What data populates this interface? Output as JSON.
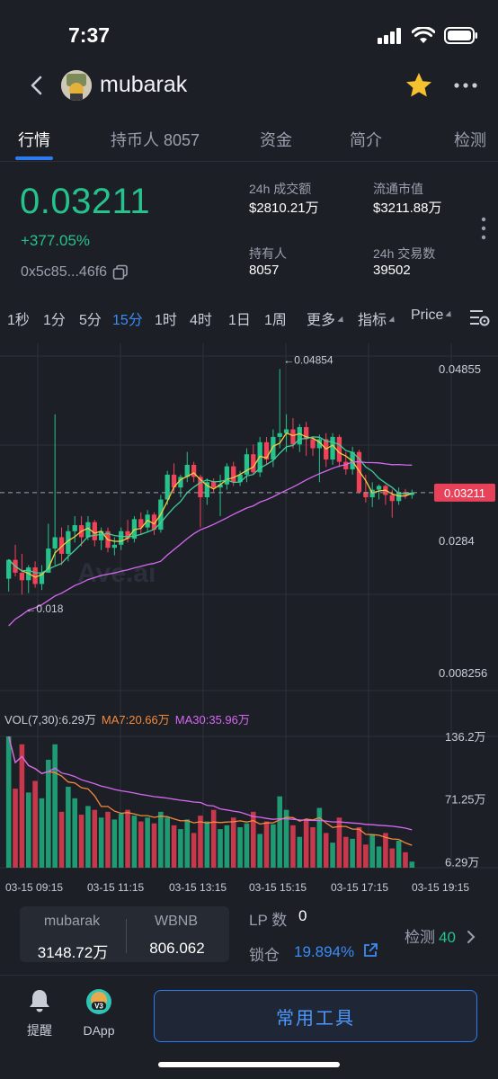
{
  "status_bar": {
    "time": "7:37",
    "icons": [
      "cellular-signal-icon",
      "wifi-icon",
      "battery-icon"
    ]
  },
  "header": {
    "token_name": "mubarak",
    "icons": [
      "back-arrow-icon",
      "token-avatar-icon",
      "star-icon",
      "more-dots-icon"
    ]
  },
  "tabs": [
    {
      "label": "行情",
      "active": true
    },
    {
      "label": "持币人 8057",
      "active": false
    },
    {
      "label": "资金",
      "active": false
    },
    {
      "label": "简介",
      "active": false
    },
    {
      "label": "检测",
      "active": false
    }
  ],
  "price": {
    "current": "0.03211",
    "change": "+377.05%",
    "address": "0x5c85...46f6"
  },
  "stats": [
    {
      "label": "24h 成交额",
      "value": "$2810.21万"
    },
    {
      "label": "流通市值",
      "value": "$3211.88万"
    },
    {
      "label": "持有人",
      "value": "8057"
    },
    {
      "label": "24h 交易数",
      "value": "39502"
    }
  ],
  "timeframes": [
    {
      "label": "1秒",
      "active": false
    },
    {
      "label": "1分",
      "active": false
    },
    {
      "label": "5分",
      "active": false
    },
    {
      "label": "15分",
      "active": true
    },
    {
      "label": "1时",
      "active": false
    },
    {
      "label": "4时",
      "active": false
    },
    {
      "label": "1日",
      "active": false
    },
    {
      "label": "1周",
      "active": false
    }
  ],
  "dropdowns": [
    {
      "label": "更多"
    },
    {
      "label": "指标"
    },
    {
      "label": "Price"
    }
  ],
  "chart_data": {
    "type": "candlestick",
    "watermark": "Ave.ai",
    "price_axis_labels": [
      "0.04855",
      "0.0284",
      "0.008256"
    ],
    "y_range": [
      0.008256,
      0.04855
    ],
    "current_price_tag": "0.03211",
    "high_annotation": "0.04854",
    "low_annotation": "0.018",
    "x_tick_labels": [
      "03-15 09:15",
      "03-15 11:15",
      "03-15 13:15",
      "03-15 15:15",
      "03-15 17:15",
      "03-15 19:15"
    ],
    "candles": [
      {
        "o": 0.0207,
        "h": 0.0233,
        "l": 0.019,
        "c": 0.0232
      },
      {
        "o": 0.0232,
        "h": 0.0252,
        "l": 0.021,
        "c": 0.0215
      },
      {
        "o": 0.0215,
        "h": 0.024,
        "l": 0.0186,
        "c": 0.0205
      },
      {
        "o": 0.0205,
        "h": 0.0225,
        "l": 0.0188,
        "c": 0.0222
      },
      {
        "o": 0.0222,
        "h": 0.023,
        "l": 0.0195,
        "c": 0.02
      },
      {
        "o": 0.02,
        "h": 0.0225,
        "l": 0.0192,
        "c": 0.0215
      },
      {
        "o": 0.0215,
        "h": 0.028,
        "l": 0.0215,
        "c": 0.0247
      },
      {
        "o": 0.0247,
        "h": 0.0425,
        "l": 0.0225,
        "c": 0.0262
      },
      {
        "o": 0.0262,
        "h": 0.0275,
        "l": 0.0225,
        "c": 0.024
      },
      {
        "o": 0.024,
        "h": 0.0278,
        "l": 0.023,
        "c": 0.027
      },
      {
        "o": 0.027,
        "h": 0.029,
        "l": 0.0255,
        "c": 0.0278
      },
      {
        "o": 0.0278,
        "h": 0.029,
        "l": 0.025,
        "c": 0.0262
      },
      {
        "o": 0.0262,
        "h": 0.029,
        "l": 0.0258,
        "c": 0.0282
      },
      {
        "o": 0.0282,
        "h": 0.0285,
        "l": 0.025,
        "c": 0.0258
      },
      {
        "o": 0.0258,
        "h": 0.0275,
        "l": 0.0245,
        "c": 0.027
      },
      {
        "o": 0.027,
        "h": 0.0275,
        "l": 0.0242,
        "c": 0.0248
      },
      {
        "o": 0.0248,
        "h": 0.0262,
        "l": 0.0238,
        "c": 0.0252
      },
      {
        "o": 0.0252,
        "h": 0.0275,
        "l": 0.0245,
        "c": 0.027
      },
      {
        "o": 0.027,
        "h": 0.0285,
        "l": 0.0255,
        "c": 0.026
      },
      {
        "o": 0.026,
        "h": 0.029,
        "l": 0.0255,
        "c": 0.0286
      },
      {
        "o": 0.0286,
        "h": 0.0295,
        "l": 0.0265,
        "c": 0.0275
      },
      {
        "o": 0.0275,
        "h": 0.0298,
        "l": 0.027,
        "c": 0.0292
      },
      {
        "o": 0.0292,
        "h": 0.0295,
        "l": 0.0265,
        "c": 0.0272
      },
      {
        "o": 0.0272,
        "h": 0.0318,
        "l": 0.0268,
        "c": 0.0312
      },
      {
        "o": 0.0312,
        "h": 0.035,
        "l": 0.0305,
        "c": 0.0345
      },
      {
        "o": 0.0345,
        "h": 0.036,
        "l": 0.032,
        "c": 0.0328
      },
      {
        "o": 0.0328,
        "h": 0.0345,
        "l": 0.0315,
        "c": 0.0342
      },
      {
        "o": 0.0342,
        "h": 0.0375,
        "l": 0.0335,
        "c": 0.0358
      },
      {
        "o": 0.0358,
        "h": 0.0362,
        "l": 0.0335,
        "c": 0.0342
      },
      {
        "o": 0.0342,
        "h": 0.0345,
        "l": 0.0275,
        "c": 0.0315
      },
      {
        "o": 0.0315,
        "h": 0.034,
        "l": 0.0305,
        "c": 0.0335
      },
      {
        "o": 0.0335,
        "h": 0.034,
        "l": 0.0322,
        "c": 0.0328
      },
      {
        "o": 0.0328,
        "h": 0.0345,
        "l": 0.029,
        "c": 0.0332
      },
      {
        "o": 0.0332,
        "h": 0.036,
        "l": 0.0325,
        "c": 0.0356
      },
      {
        "o": 0.0356,
        "h": 0.0362,
        "l": 0.033,
        "c": 0.0335
      },
      {
        "o": 0.0335,
        "h": 0.035,
        "l": 0.033,
        "c": 0.0345
      },
      {
        "o": 0.0345,
        "h": 0.038,
        "l": 0.0335,
        "c": 0.0372
      },
      {
        "o": 0.0372,
        "h": 0.0385,
        "l": 0.0345,
        "c": 0.0348
      },
      {
        "o": 0.0348,
        "h": 0.0395,
        "l": 0.0342,
        "c": 0.0388
      },
      {
        "o": 0.0388,
        "h": 0.0395,
        "l": 0.0358,
        "c": 0.0365
      },
      {
        "o": 0.0365,
        "h": 0.0405,
        "l": 0.0355,
        "c": 0.0395
      },
      {
        "o": 0.0395,
        "h": 0.0485,
        "l": 0.038,
        "c": 0.04
      },
      {
        "o": 0.04,
        "h": 0.0425,
        "l": 0.0375,
        "c": 0.0405
      },
      {
        "o": 0.0405,
        "h": 0.042,
        "l": 0.038,
        "c": 0.0385
      },
      {
        "o": 0.0385,
        "h": 0.0412,
        "l": 0.0375,
        "c": 0.0408
      },
      {
        "o": 0.0408,
        "h": 0.0415,
        "l": 0.037,
        "c": 0.0392
      },
      {
        "o": 0.0392,
        "h": 0.0395,
        "l": 0.037,
        "c": 0.038
      },
      {
        "o": 0.038,
        "h": 0.0398,
        "l": 0.0335,
        "c": 0.0392
      },
      {
        "o": 0.0392,
        "h": 0.04,
        "l": 0.0355,
        "c": 0.0365
      },
      {
        "o": 0.0365,
        "h": 0.04,
        "l": 0.0358,
        "c": 0.0395
      },
      {
        "o": 0.0395,
        "h": 0.0398,
        "l": 0.0355,
        "c": 0.0362
      },
      {
        "o": 0.0362,
        "h": 0.0375,
        "l": 0.0345,
        "c": 0.0352
      },
      {
        "o": 0.0352,
        "h": 0.0382,
        "l": 0.0345,
        "c": 0.0375
      },
      {
        "o": 0.0375,
        "h": 0.0378,
        "l": 0.032,
        "c": 0.0322
      },
      {
        "o": 0.0322,
        "h": 0.0345,
        "l": 0.0308,
        "c": 0.0315
      },
      {
        "o": 0.0315,
        "h": 0.0335,
        "l": 0.0302,
        "c": 0.0325
      },
      {
        "o": 0.0325,
        "h": 0.0332,
        "l": 0.0312,
        "c": 0.033
      },
      {
        "o": 0.033,
        "h": 0.0332,
        "l": 0.0305,
        "c": 0.0318
      },
      {
        "o": 0.0318,
        "h": 0.0325,
        "l": 0.0288,
        "c": 0.031
      },
      {
        "o": 0.031,
        "h": 0.0328,
        "l": 0.0305,
        "c": 0.0322
      },
      {
        "o": 0.0322,
        "h": 0.0326,
        "l": 0.0313,
        "c": 0.0318
      },
      {
        "o": 0.0318,
        "h": 0.0325,
        "l": 0.0313,
        "c": 0.0321
      }
    ],
    "ma_series": [
      {
        "name": "MA (yellow)",
        "color": "#f4d03f"
      },
      {
        "name": "MA (teal)",
        "color": "#3fcf9a"
      },
      {
        "name": "MA (violet)",
        "color": "#d668f2"
      }
    ],
    "volume_legend": [
      {
        "text": "VOL(7,30):6.29万",
        "color": "#c9cdd6"
      },
      {
        "text": "MA7:20.66万",
        "color": "#f58a3c"
      },
      {
        "text": "MA30:35.96万",
        "color": "#d668f2"
      }
    ],
    "volume_axis_labels": [
      "136.2万",
      "71.25万",
      "6.29万"
    ],
    "volume_range": [
      0,
      136.2
    ],
    "volumes": [
      136.2,
      82,
      128,
      78,
      90,
      72,
      112,
      128,
      58,
      84,
      72,
      55,
      64,
      60,
      52,
      58,
      50,
      56,
      60,
      54,
      48,
      52,
      46,
      58,
      52,
      44,
      40,
      50,
      36,
      54,
      48,
      60,
      40,
      44,
      52,
      42,
      46,
      58,
      35,
      48,
      45,
      74,
      60,
      44,
      32,
      50,
      42,
      62,
      36,
      26,
      52,
      32,
      30,
      42,
      24,
      34,
      22,
      36,
      20,
      28,
      16,
      6.29
    ]
  },
  "pair": {
    "base_name": "mubarak",
    "base_amount": "3148.72万",
    "quote_name": "WBNB",
    "quote_amount": "806.062"
  },
  "lp": {
    "label": "LP 数",
    "value": "0"
  },
  "lock": {
    "label": "锁仓",
    "value": "19.894%"
  },
  "check": {
    "label": "检测",
    "count": "40"
  },
  "footer": {
    "alert_label": "提醒",
    "dapp_label": "DApp",
    "dapp_badge": "V3",
    "tools_button": "常用工具"
  }
}
